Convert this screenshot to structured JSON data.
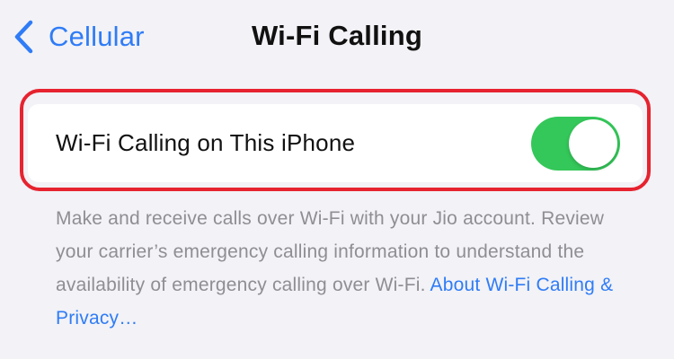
{
  "nav": {
    "back_label": "Cellular",
    "title": "Wi-Fi Calling"
  },
  "setting": {
    "label": "Wi-Fi Calling on This iPhone",
    "toggle_on": true
  },
  "footer": {
    "description": "Make and receive calls over Wi-Fi with your Jio account. Review your carrier’s emergency calling information to understand the availability of emergency calling over Wi-Fi.",
    "link_label": "About Wi-Fi Calling & Privacy…"
  },
  "colors": {
    "accent": "#2f7cf6",
    "toggle_on": "#34c759",
    "highlight": "#e6232f",
    "background": "#f2f2f7"
  },
  "icons": {
    "back": "chevron-left-icon"
  }
}
